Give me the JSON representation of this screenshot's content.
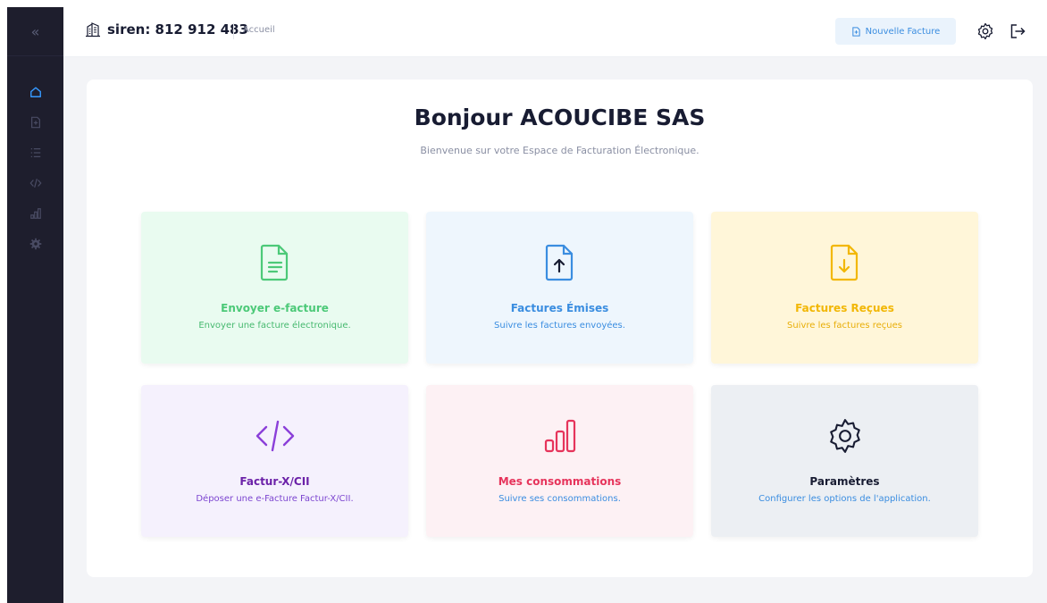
{
  "sidebar": {
    "collapse_glyph": "«",
    "items": [
      {
        "icon": "home-icon",
        "color": "#3699ff"
      },
      {
        "icon": "new-invoice-icon",
        "color": "#494b63"
      },
      {
        "icon": "list-icon",
        "color": "#494b63"
      },
      {
        "icon": "code-icon",
        "color": "#494b63"
      },
      {
        "icon": "bar-chart-icon",
        "color": "#494b63"
      },
      {
        "icon": "gear-icon",
        "color": "#494b63"
      }
    ]
  },
  "header": {
    "siren_label": "siren: 812 912 483",
    "breadcrumb": "Accueil",
    "new_invoice_label": "Nouvelle Facture"
  },
  "main": {
    "greeting": "Bonjour ACOUCIBE SAS",
    "subtitle": "Bienvenue sur votre Espace de Facturation Électronique."
  },
  "tiles": [
    {
      "title": "Envoyer e-facture",
      "desc": "Envoyer une facture électronique.",
      "icon": "document-text-icon",
      "bg": "#e9fbf0",
      "accent": "#4cc978",
      "desc_color": "#46b96f"
    },
    {
      "title": "Factures Émises",
      "desc": "Suivre les factures envoyées.",
      "icon": "document-upload-icon",
      "bg": "#eef6fd",
      "accent": "#3a8de0",
      "desc_color": "#3a8de0"
    },
    {
      "title": "Factures Reçues",
      "desc": "Suivre les factures reçues",
      "icon": "document-download-icon",
      "bg": "#fff6d9",
      "accent": "#f2b705",
      "desc_color": "#e8ae08"
    },
    {
      "title": "Factur-X/CII",
      "desc": "Déposer une e-Facture Factur-X/CII.",
      "icon": "code-icon",
      "bg": "#f5f1fd",
      "accent": "#8b3fd9",
      "desc_color": "#7c45d0"
    },
    {
      "title": "Mes consommations",
      "desc": "Suivre ses consommations.",
      "icon": "bar-chart-icon",
      "bg": "#fdf1f4",
      "accent": "#e6345b",
      "desc_color": "#3a8de0"
    },
    {
      "title": "Paramètres",
      "desc": "Configurer les options de l'application.",
      "icon": "gear-icon",
      "bg": "#eceff3",
      "accent": "#181c32",
      "desc_color": "#3a8de0"
    }
  ]
}
